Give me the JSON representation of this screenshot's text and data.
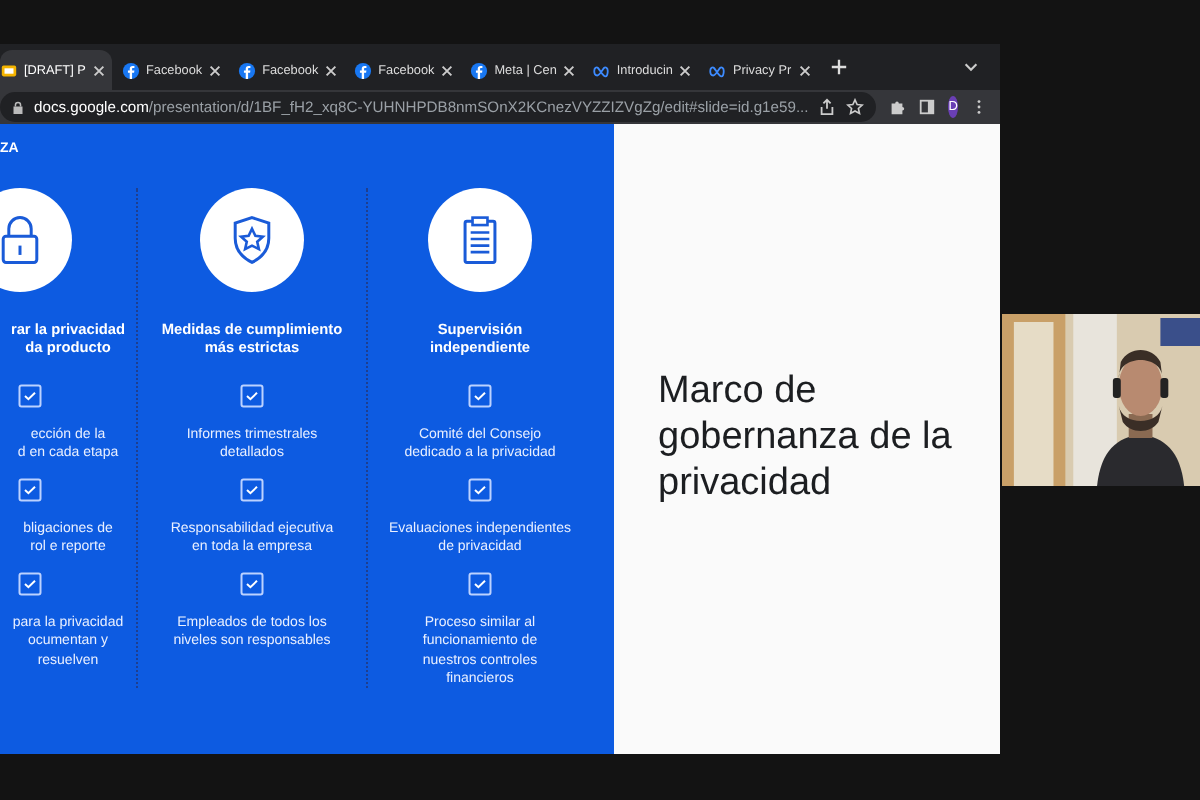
{
  "tabs": [
    {
      "label": "[DRAFT] P",
      "kind": "slides",
      "selected": true
    },
    {
      "label": "Facebook",
      "kind": "facebook",
      "selected": false
    },
    {
      "label": "Facebook",
      "kind": "facebook",
      "selected": false
    },
    {
      "label": "Facebook",
      "kind": "facebook",
      "selected": false
    },
    {
      "label": "Meta | Cen",
      "kind": "facebook",
      "selected": false
    },
    {
      "label": "Introducin",
      "kind": "meta",
      "selected": false
    },
    {
      "label": "Privacy Pr",
      "kind": "meta",
      "selected": false
    }
  ],
  "address": {
    "host": "docs.google.com",
    "path": "/presentation/d/1BF_fH2_xq8C-YUHNHPDB8nmSOnX2KCnezVYZZIZVgZg/edit#slide=id.g1e59..."
  },
  "avatar": "D",
  "slide": {
    "section": "ZA",
    "title": "Marco de gobernanza de la privacidad",
    "columns": [
      {
        "kind": "lock",
        "title": "rar la privacidad\nda producto",
        "items": [
          "ección de la\nd en cada etapa",
          "bligaciones de\nrol e reporte",
          "para la privacidad\nocumentan y\nresuelven"
        ]
      },
      {
        "kind": "shield",
        "title": "Medidas de cumplimiento\nmás estrictas",
        "items": [
          "Informes trimestrales\ndetallados",
          "Responsabilidad ejecutiva\nen toda la empresa",
          "Empleados de todos los\nniveles son responsables"
        ]
      },
      {
        "kind": "clipboard",
        "title": "Supervisión\nindependiente",
        "items": [
          "Comité del Consejo\ndedicado a la privacidad",
          "Evaluaciones independientes\nde privacidad",
          "Proceso similar al\nfuncionamiento de\nnuestros controles\nfinancieros"
        ]
      }
    ]
  }
}
